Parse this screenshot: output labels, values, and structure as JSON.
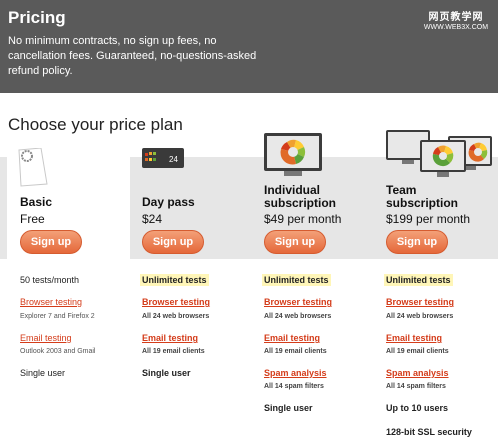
{
  "header": {
    "title": "Pricing",
    "description": "No minimum contracts, no sign up fees, no cancellation fees. Guaranteed, no-questions-asked refund policy.",
    "watermark_top": "网页教学网",
    "watermark_bottom": "WWW.WEB3X.COM"
  },
  "subtitle": "Choose your price plan",
  "plans": [
    {
      "icon": "paper-report-icon",
      "name_line1": "Basic",
      "name_line2": "",
      "price": "Free",
      "signup_label": "Sign up",
      "tests": "50 tests/month",
      "browser_link": "Browser testing",
      "browser_detail": "Explorer 7 and Firefox 2",
      "email_link": "Email testing",
      "email_detail": "Outlook 2003 and Gmail",
      "spam_link": "",
      "spam_detail": "",
      "users": "Single user",
      "extra": ""
    },
    {
      "icon": "day-pass-card-icon",
      "icon_text": "24",
      "name_line1": "Day pass",
      "name_line2": "",
      "price": "$24",
      "signup_label": "Sign up",
      "tests": "Unlimited tests",
      "browser_link": "Browser testing",
      "browser_detail": "All 24 web browsers",
      "email_link": "Email testing",
      "email_detail": "All 19 email clients",
      "spam_link": "",
      "spam_detail": "",
      "users": "Single user",
      "extra": ""
    },
    {
      "icon": "monitor-icon",
      "name_line1": "Individual",
      "name_line2": "subscription",
      "price": "$49 per month",
      "signup_label": "Sign up",
      "tests": "Unlimited tests",
      "browser_link": "Browser testing",
      "browser_detail": "All 24 web browsers",
      "email_link": "Email testing",
      "email_detail": "All 19 email clients",
      "spam_link": "Spam analysis",
      "spam_detail": "All 14 spam filters",
      "users": "Single user",
      "extra": ""
    },
    {
      "icon": "multiple-monitors-icon",
      "name_line1": "Team",
      "name_line2": "subscription",
      "price": "$199 per month",
      "signup_label": "Sign up",
      "tests": "Unlimited tests",
      "browser_link": "Browser testing",
      "browser_detail": "All 24 web browsers",
      "email_link": "Email testing",
      "email_detail": "All 19 email clients",
      "spam_link": "Spam analysis",
      "spam_detail": "All 14 spam filters",
      "users": "Up to 10 users",
      "extra": "128-bit SSL security"
    }
  ],
  "colors": {
    "header_bg": "#5a5a5a",
    "button": "#e5683a",
    "link": "#d43c1a",
    "highlight": "#fff6b8"
  }
}
